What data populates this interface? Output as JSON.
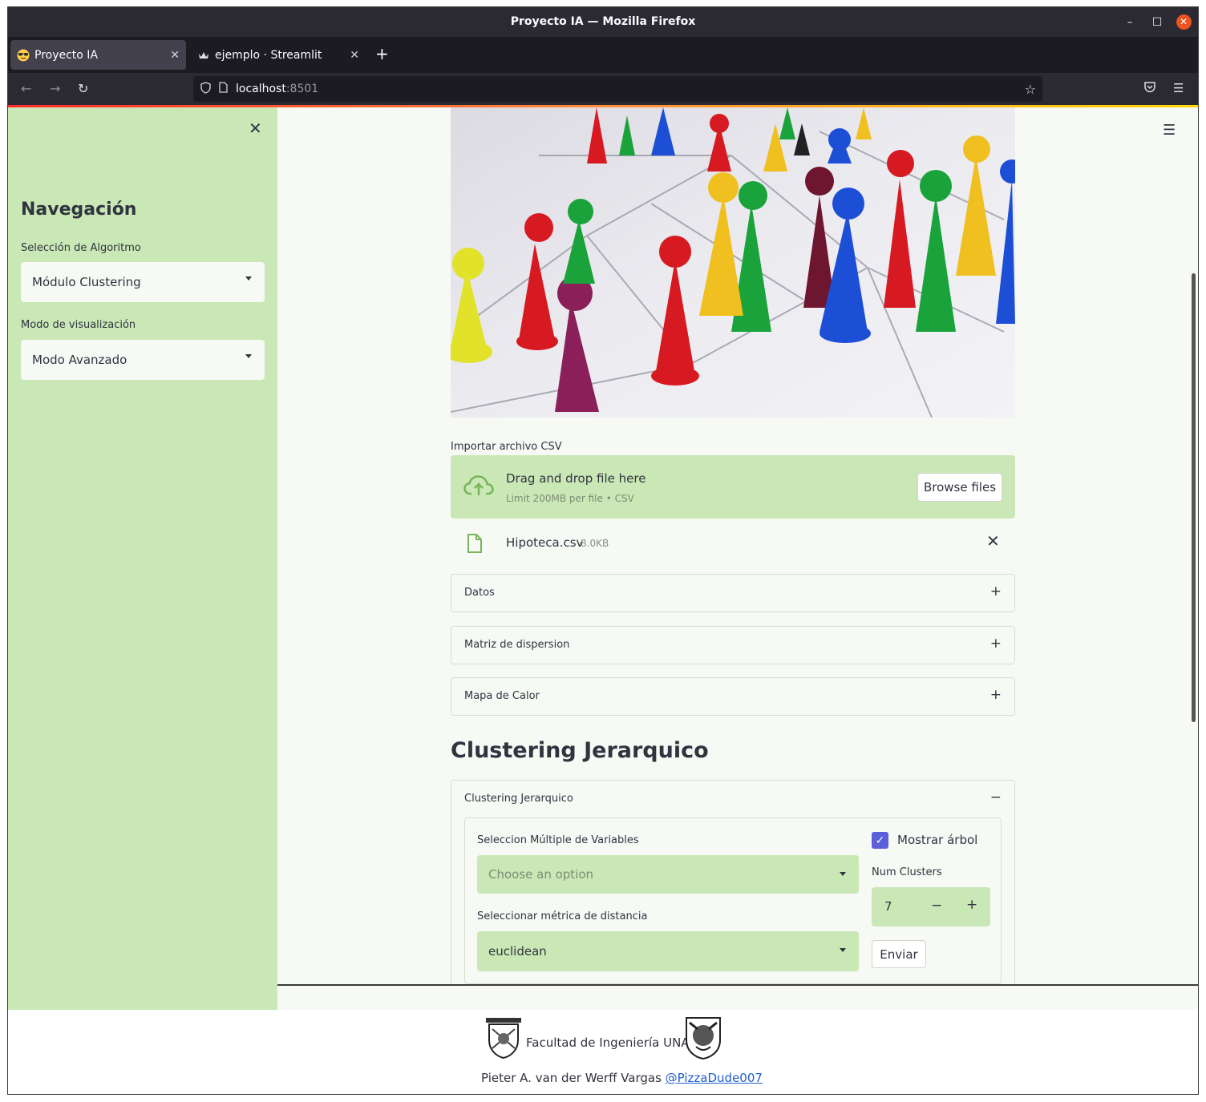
{
  "browser": {
    "window_title": "Proyecto IA — Mozilla Firefox",
    "tabs": [
      {
        "label": "Proyecto IA",
        "icon": "sunglasses-emoji-icon",
        "active": true
      },
      {
        "label": "ejemplo · Streamlit",
        "icon": "streamlit-crown-icon",
        "active": false
      }
    ],
    "url_host": "localhost",
    "url_port": ":8501"
  },
  "sidebar": {
    "title": "Navegación",
    "algo_label": "Selección de Algoritmo",
    "algo_value": "Módulo Clustering",
    "mode_label": "Modo de visualización",
    "mode_value": "Modo Avanzado"
  },
  "uploader": {
    "label": "Importar archivo CSV",
    "drag_text": "Drag and drop file here",
    "limit_text": "Limit 200MB per file • CSV",
    "browse_label": "Browse files",
    "file_name": "Hipoteca.csv",
    "file_size": "8.0KB"
  },
  "expanders": [
    {
      "label": "Datos",
      "sign": "+"
    },
    {
      "label": "Matriz de dispersion",
      "sign": "+"
    },
    {
      "label": "Mapa de Calor",
      "sign": "+"
    }
  ],
  "section_title": "Clustering Jerarquico",
  "clustering": {
    "expander_label": "Clustering Jerarquico",
    "expander_sign": "−",
    "vars_label": "Seleccion Múltiple de Variables",
    "vars_placeholder": "Choose an option",
    "metric_label": "Seleccionar métrica de distancia",
    "metric_value": "euclidean",
    "tree_label": "Mostrar árbol",
    "tree_checked": true,
    "num_label": "Num Clusters",
    "num_value": "7",
    "submit_label": "Enviar"
  },
  "footer": {
    "institution": "Facultad de Ingeniería UNAM",
    "author": "Pieter A. van der Werff Vargas",
    "handle": "@PizzaDude007"
  },
  "colors": {
    "accent_green": "#c9e8b6",
    "checkbox": "#5b5fd9",
    "link": "#1f5fd1"
  }
}
